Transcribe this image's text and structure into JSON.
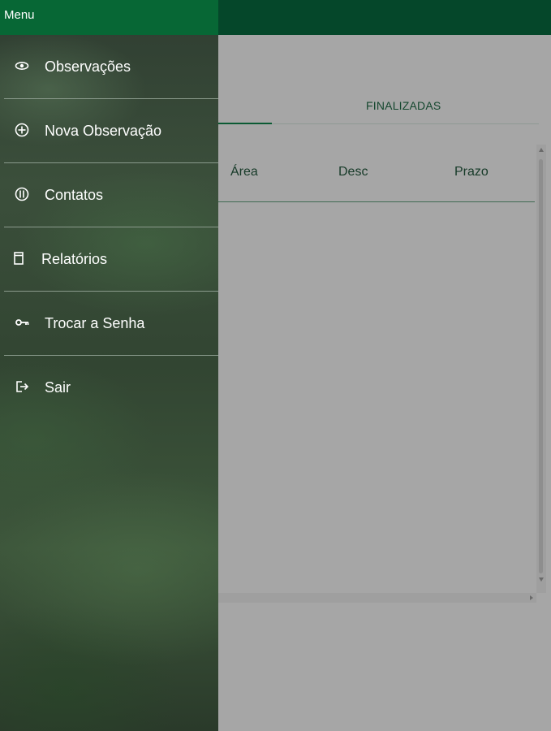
{
  "drawer": {
    "title": "Menu",
    "items": [
      {
        "label": "Observações",
        "icon": "eye-icon"
      },
      {
        "label": "Nova Observação",
        "icon": "plus-circle-icon"
      },
      {
        "label": "Contatos",
        "icon": "contacts-icon"
      },
      {
        "label": "Relatórios",
        "icon": "report-icon"
      },
      {
        "label": "Trocar a Senha",
        "icon": "key-icon"
      },
      {
        "label": "Sair",
        "icon": "logout-icon"
      }
    ]
  },
  "main": {
    "tabs": [
      {
        "label": "",
        "active": true
      },
      {
        "label": "FINALIZADAS",
        "active": false
      }
    ],
    "table": {
      "columns": [
        "Área",
        "Desc",
        "Prazo"
      ]
    }
  },
  "colors": {
    "header_dark": "#05472a",
    "drawer_header": "#076735",
    "overlay_gray": "#a6a6a6"
  }
}
